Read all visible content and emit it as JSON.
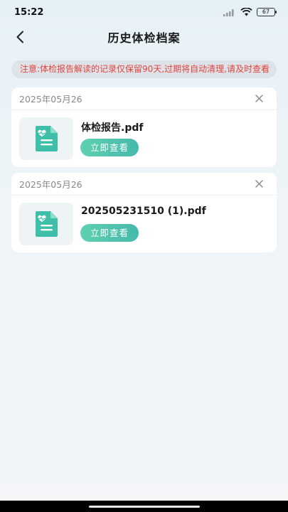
{
  "status_bar": {
    "time": "15:22",
    "battery": "67"
  },
  "nav": {
    "title": "历史体检档案"
  },
  "notice": {
    "text": "注意:体检报告解读的记录仅保留90天,过期将自动清理,请及时查看"
  },
  "records": [
    {
      "date": "2025年05月26",
      "file_name": "体检报告.pdf",
      "action_label": "立即查看"
    },
    {
      "date": "2025年05月26",
      "file_name": "202505231510 (1).pdf",
      "action_label": "立即查看"
    }
  ],
  "colors": {
    "accent_start": "#5fd0b1",
    "accent_end": "#45b9ab",
    "notice_text": "#e0443d",
    "icon_teal": "#3dbfa9"
  }
}
